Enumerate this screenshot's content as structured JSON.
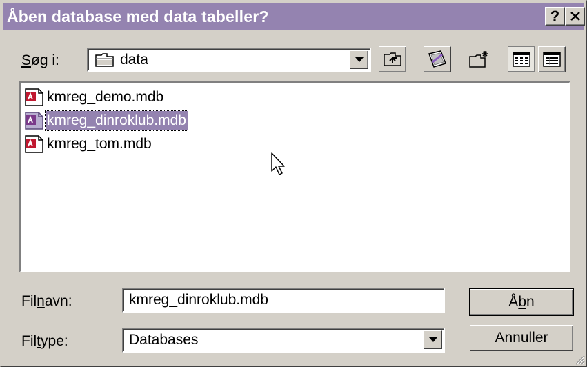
{
  "window": {
    "title": "Åben database med data tabeller?",
    "help_label": "?",
    "close_label": "✕",
    "title_bar_color": "#9483b0"
  },
  "lookin": {
    "label_prefix": "",
    "label_mnemonic": "S",
    "label_rest": "øg i:",
    "value": "data",
    "icon": "folder-icon"
  },
  "toolbar": {
    "buttons": [
      {
        "name": "up-one-level-button",
        "icon": "up-folder-icon"
      },
      {
        "name": "desktop-button",
        "icon": "desktop-icon"
      },
      {
        "name": "new-folder-button",
        "icon": "new-folder-icon"
      },
      {
        "name": "list-view-button",
        "icon": "list-view-icon"
      },
      {
        "name": "details-view-button",
        "icon": "details-view-icon"
      }
    ]
  },
  "files": [
    {
      "name": "kmreg_demo.mdb",
      "selected": false,
      "icon": "access-db-icon"
    },
    {
      "name": "kmreg_dinroklub.mdb",
      "selected": true,
      "icon": "access-db-icon"
    },
    {
      "name": "kmreg_tom.mdb",
      "selected": false,
      "icon": "access-db-icon"
    }
  ],
  "filename": {
    "label_prefix": "Fil",
    "label_mnemonic": "n",
    "label_rest": "avn:",
    "value": "kmreg_dinroklub.mdb"
  },
  "filetype": {
    "label_prefix": "Fil",
    "label_mnemonic": "t",
    "label_rest": "ype:",
    "value": "Databases"
  },
  "buttons": {
    "open_prefix": "Å",
    "open_mnemonic": "b",
    "open_rest": "n",
    "cancel_label": "Annuller"
  }
}
